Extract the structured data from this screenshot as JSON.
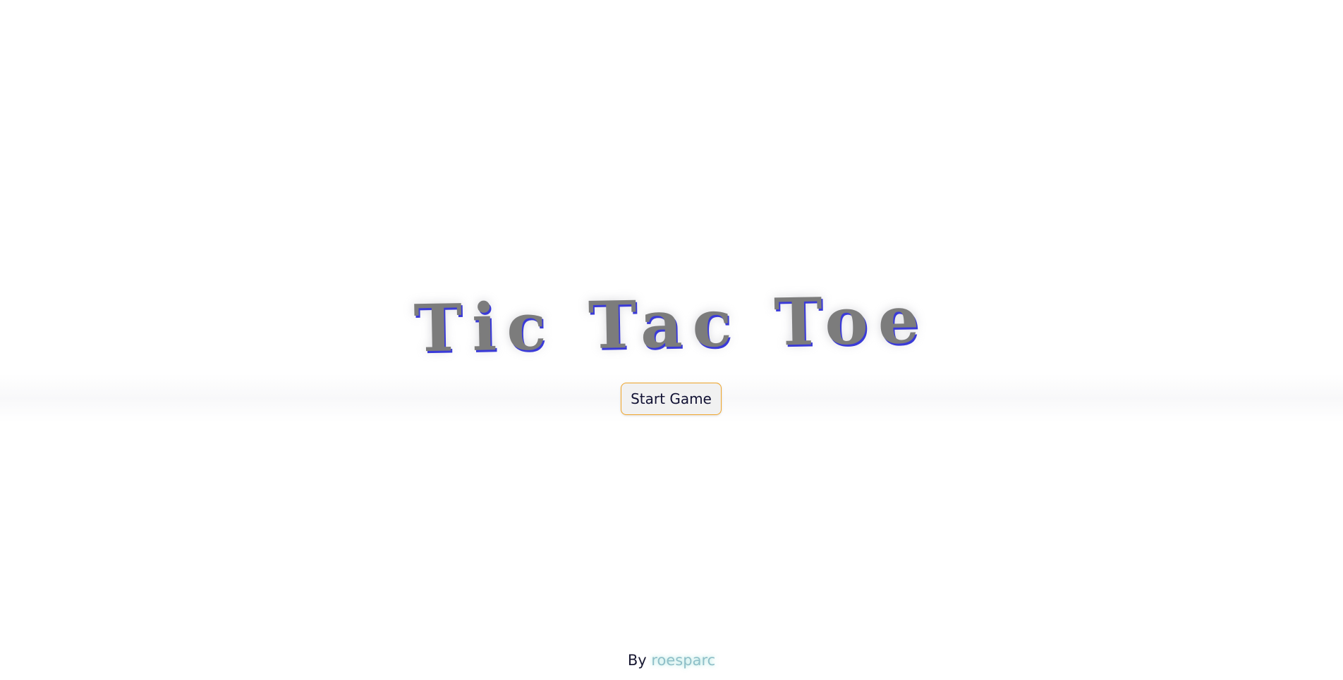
{
  "title": "Tic Tac Toe",
  "start_button": {
    "label": "Start Game"
  },
  "footer": {
    "prefix": "By",
    "author": "roesparc"
  },
  "colors": {
    "title_fill": "#7c7c7c",
    "title_shadow": "#3a3ad8",
    "button_border": "#f0a528",
    "button_bg": "#f1f1f1",
    "author_link": "#8fbfc8"
  }
}
